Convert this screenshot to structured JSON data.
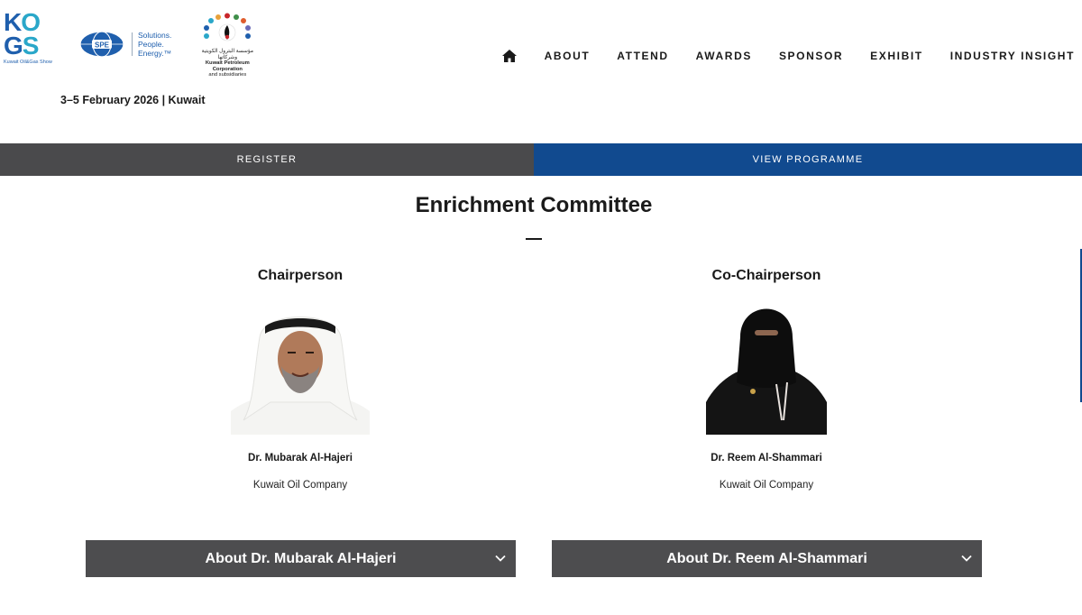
{
  "header": {
    "logos": {
      "kogs": {
        "letters": [
          "K",
          "O",
          "G",
          "S"
        ],
        "subtitle": "Kuwait Oil&Gas Show"
      },
      "spe": {
        "mark": "SPE",
        "tagline": [
          "Solutions.",
          "People.",
          "Energy.™"
        ]
      },
      "kpc": {
        "arabic": "مؤسسة البترول الكويتية وشركاتها",
        "english": "Kuwait Petroleum Corporation",
        "english_sub": "and subsidiaries"
      }
    },
    "event_date": "3–5 February 2026 | Kuwait",
    "nav": {
      "home_icon": "home-icon",
      "items": [
        "ABOUT",
        "ATTEND",
        "AWARDS",
        "SPONSOR",
        "EXHIBIT",
        "INDUSTRY INSIGHT"
      ]
    }
  },
  "cta": {
    "register": "REGISTER",
    "view_programme": "VIEW PROGRAMME"
  },
  "main": {
    "title": "Enrichment Committee",
    "members": [
      {
        "role": "Chairperson",
        "name": "Dr. Mubarak Al-Hajeri",
        "organization": "Kuwait Oil Company",
        "about_label": "About Dr. Mubarak Al-Hajeri"
      },
      {
        "role": "Co-Chairperson",
        "name": "Dr. Reem Al-Shammari",
        "organization": "Kuwait Oil Company",
        "about_label": "About Dr. Reem Al-Shammari"
      }
    ]
  },
  "colors": {
    "register_bg": "#4a4a4c",
    "programme_bg": "#114a8f",
    "accordion_bg": "#4d4d4f",
    "brand_blue": "#1f5fad",
    "brand_teal": "#2aa7c9"
  }
}
